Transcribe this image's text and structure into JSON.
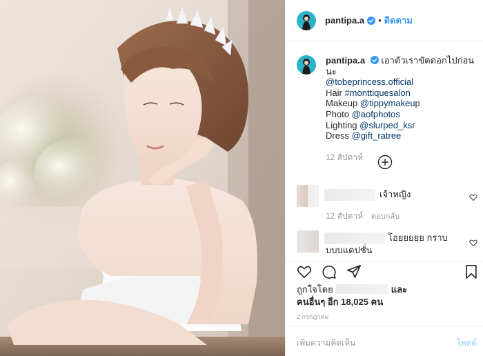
{
  "post": {
    "username": "pantipa.a",
    "dot": "•",
    "follow_label": "ติดตาม"
  },
  "caption": {
    "username": "pantipa.a",
    "text": "เอาตัวเราขัดดอกไปก่อนนะ",
    "lines": [
      {
        "prefix": "",
        "link": "@tobeprincess.official"
      },
      {
        "prefix": "Hair ",
        "link": "#monttiquesalon"
      },
      {
        "prefix": "Makeup ",
        "link": "@tippymakeup"
      },
      {
        "prefix": "Photo ",
        "link": "@aofphotos"
      },
      {
        "prefix": "Lighting ",
        "link": "@slurped_ksr"
      },
      {
        "prefix": "Dress ",
        "link": "@gift_ratree"
      }
    ],
    "time": "12 สัปดาห์"
  },
  "comments": [
    {
      "text": "เจ้าหญิง",
      "time": "12 สัปดาห์",
      "reply": "ตอบกลับ"
    },
    {
      "text_line1": "โอยยยยย กราบ",
      "text_line2": "บบบแดปชั่น"
    }
  ],
  "likes": {
    "prefix": "ถูกใจโดย",
    "and": "และ",
    "others": "คนอื่นๆ อีก 18,025 คน"
  },
  "date": "2 กรกฎาคม",
  "add_comment": {
    "placeholder": "เพิ่มความคิดเห็น",
    "post_label": "โพสต์"
  },
  "icons": {
    "more": "plus-circle-icon",
    "like": "heart-icon",
    "comment": "comment-icon",
    "share": "share-icon",
    "save": "bookmark-icon"
  },
  "colors": {
    "link": "#003569",
    "follow": "#3897f0",
    "verified": "#3897f0",
    "muted": "#999999"
  }
}
